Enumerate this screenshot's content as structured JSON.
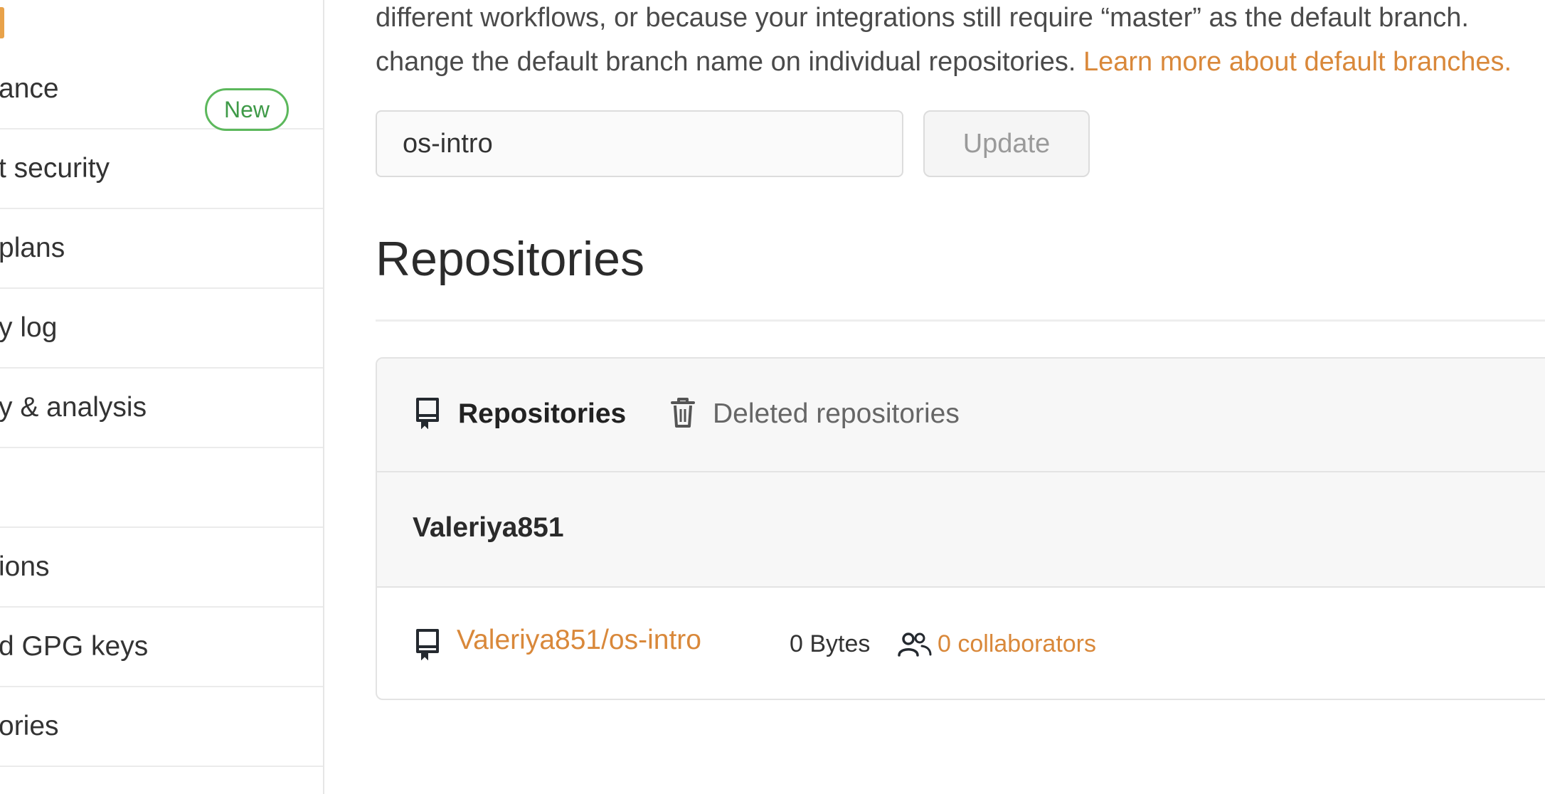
{
  "sidebar": {
    "items": [
      {
        "label": "ance"
      },
      {
        "label": "t security"
      },
      {
        "label": " plans"
      },
      {
        "label": "y log"
      },
      {
        "label": "y & analysis"
      },
      {
        "label": ""
      },
      {
        "label": "ions"
      },
      {
        "label": "d GPG keys"
      },
      {
        "label": "ories"
      }
    ],
    "new_badge": "New",
    "accent_color": "#e8a24a"
  },
  "main": {
    "intro": {
      "line1": "different workflows, or because your integrations still require “master” as the default branch.",
      "line2_text": "change the default branch name on individual repositories. ",
      "line2_link": "Learn more about default branches."
    },
    "default_branch": {
      "value": "os-intro",
      "update_label": "Update"
    },
    "repositories": {
      "title": "Repositories",
      "tabs": {
        "repositories": "Repositories",
        "deleted": "Deleted repositories"
      },
      "owner": "Valeriya851",
      "items": [
        {
          "name": "Valeriya851/os-intro",
          "size": "0 Bytes",
          "collaborators": "0 collaborators"
        }
      ]
    }
  },
  "colors": {
    "link": "#d9883a",
    "badge_green": "#5cb85c"
  },
  "icons": {
    "repo": "repo-icon",
    "trash": "trash-icon",
    "people": "people-icon"
  }
}
